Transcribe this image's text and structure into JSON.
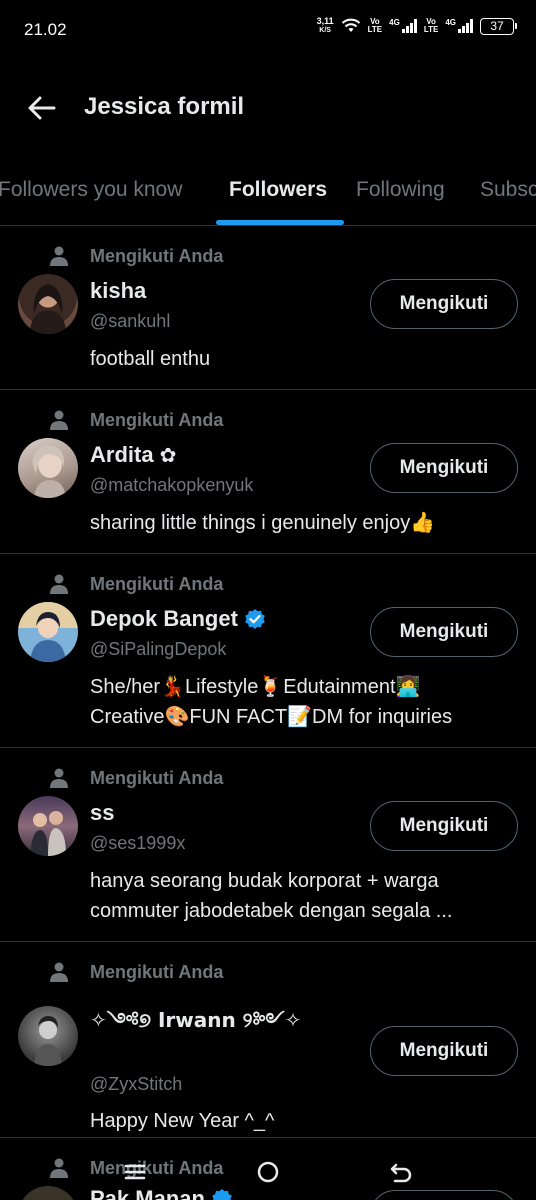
{
  "status": {
    "time": "21.02",
    "speed_value": "3,11",
    "speed_unit": "K/S",
    "vo_label": "Vo",
    "lte_label": "LTE",
    "net_4g": "4G",
    "battery": "37"
  },
  "header": {
    "title": "Jessica formil"
  },
  "tabs": [
    {
      "label": "Followers you know"
    },
    {
      "label": "Followers"
    },
    {
      "label": "Following"
    },
    {
      "label": "Subsc"
    }
  ],
  "users": [
    {
      "follow_label": "Mengikuti Anda",
      "name": "kisha",
      "handle": "@sankuhl",
      "bio": [
        "football enthu"
      ],
      "button": "Mengikuti"
    },
    {
      "follow_label": "Mengikuti Anda",
      "name": "Ardita",
      "name_suffix": "✿",
      "handle": "@matchakopkenyuk",
      "bio": [
        "sharing little things i genuinely enjoy👍"
      ],
      "button": "Mengikuti"
    },
    {
      "follow_label": "Mengikuti Anda",
      "name": "Depok Banget",
      "verified": true,
      "handle": "@SiPalingDepok",
      "bio": [
        "She/her💃Lifestyle🍹Edutainment👩‍💻",
        "Creative🎨FUN FACT📝DM for inquiries"
      ],
      "button": "Mengikuti"
    },
    {
      "follow_label": "Mengikuti Anda",
      "name": "ss",
      "handle": "@ses1999x",
      "bio": [
        "hanya seorang budak korporat + warga",
        "commuter jabodetabek dengan segala ..."
      ],
      "button": "Mengikuti"
    },
    {
      "follow_label": "Mengikuti Anda",
      "name": "✧༺୭ Irwann ୨༻✧",
      "handle": "@ZyxStitch",
      "bio": [
        "Happy New Year ^_^"
      ],
      "button": "Mengikuti"
    },
    {
      "follow_label": "Mengikuti Anda",
      "name": "Pak Manan",
      "verified": true,
      "handle": "",
      "bio": [],
      "button": ""
    }
  ],
  "colors": {
    "accent": "#1d9bf0",
    "background": "#000000",
    "text": "#e7e9ea",
    "muted": "#71767b",
    "divider": "#2f3336"
  },
  "icons": {
    "back": "arrow-left-icon",
    "person": "person-icon",
    "verified": "verified-badge-icon",
    "nav_menu": "menu-icon",
    "nav_home": "home-circle-icon",
    "nav_back": "back-icon"
  }
}
